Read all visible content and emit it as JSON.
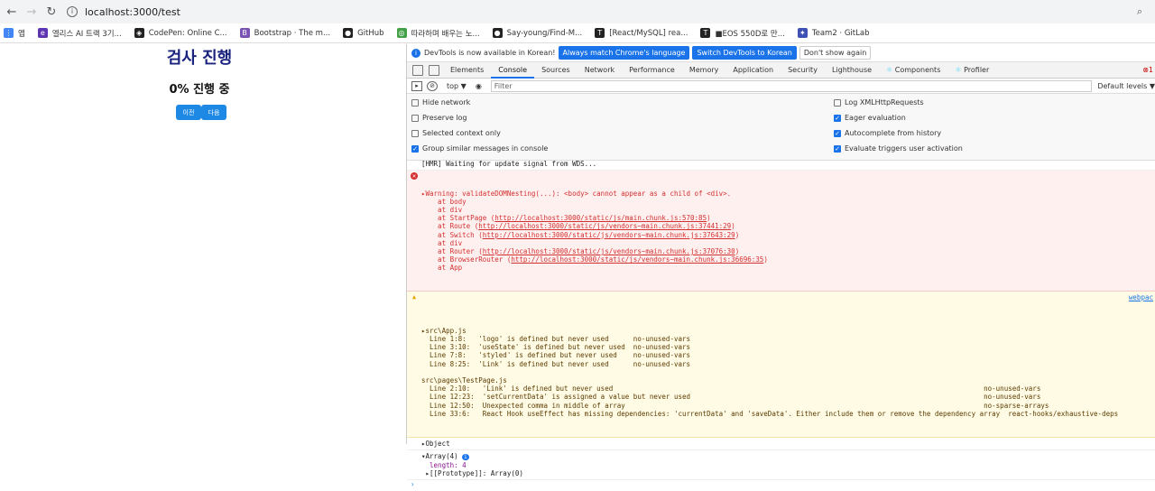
{
  "browser": {
    "url": "localhost:3000/test",
    "bookmarks": [
      {
        "label": "앱",
        "color": "#4285f4"
      },
      {
        "label": "엘리스 AI 트랙 3기...",
        "color": "#5e35b1"
      },
      {
        "label": "CodePen: Online C...",
        "color": "#222222"
      },
      {
        "label": "Bootstrap · The m...",
        "color": "#7952b3"
      },
      {
        "label": "GitHub",
        "color": "#222222"
      },
      {
        "label": "따라하며 배우는 노...",
        "color": "#43a047"
      },
      {
        "label": "Say-young/Find-M...",
        "color": "#222222"
      },
      {
        "label": "[React/MySQL] rea...",
        "color": "#222222"
      },
      {
        "label": "■EOS 550D로 만...",
        "color": "#222222"
      },
      {
        "label": "Team2 · GitLab",
        "color": "#3f51b5"
      }
    ]
  },
  "page": {
    "title": "검사 진행",
    "progress": "0% 진행 중",
    "prev_label": "이전",
    "next_label": "다음"
  },
  "devtools": {
    "info_text": "DevTools is now available in Korean!",
    "btn_match": "Always match Chrome's language",
    "btn_switch": "Switch DevTools to Korean",
    "btn_dont": "Don't show again",
    "tabs": [
      "Elements",
      "Console",
      "Sources",
      "Network",
      "Performance",
      "Memory",
      "Application",
      "Security",
      "Lighthouse",
      "Components",
      "Profiler"
    ],
    "active_tab": "Console",
    "error_count": "1",
    "context": "top ▼",
    "filter_placeholder": "Filter",
    "levels": "Default levels ▼",
    "settings": {
      "hide_network": "Hide network",
      "preserve_log": "Preserve log",
      "selected_context": "Selected context only",
      "group_similar": "Group similar messages in console",
      "log_xhr": "Log XMLHttpRequests",
      "eager_eval": "Eager evaluation",
      "autocomplete": "Autocomplete from history",
      "eval_triggers": "Evaluate triggers user activation"
    },
    "hmr": "[HMR] Waiting for update signal from WDS...",
    "error": {
      "head": "▸Warning: validateDOMNesting(...): <body> cannot appear as a child of <div>.",
      "lines": [
        "    at body",
        "    at div"
      ],
      "stack": [
        {
          "pre": "    at StartPage (",
          "link": "http://localhost:3000/static/js/main.chunk.js:570:85",
          "post": ")"
        },
        {
          "pre": "    at Route (",
          "link": "http://localhost:3000/static/js/vendors~main.chunk.js:37441:29",
          "post": ")"
        },
        {
          "pre": "    at Switch (",
          "link": "http://localhost:3000/static/js/vendors~main.chunk.js:37643:29",
          "post": ")"
        },
        {
          "pre": "    at div",
          "link": "",
          "post": ""
        },
        {
          "pre": "    at Router (",
          "link": "http://localhost:3000/static/js/vendors~main.chunk.js:37076:30",
          "post": ")"
        },
        {
          "pre": "    at BrowserRouter (",
          "link": "http://localhost:3000/static/js/vendors~main.chunk.js:36696:35",
          "post": ")"
        },
        {
          "pre": "    at App",
          "link": "",
          "post": ""
        }
      ]
    },
    "warning": {
      "source": "webpac",
      "text": "▸src\\App.js\n  Line 1:8:   'logo' is defined but never used      no-unused-vars\n  Line 3:10:  'useState' is defined but never used  no-unused-vars\n  Line 7:8:   'styled' is defined but never used    no-unused-vars\n  Line 8:25:  'Link' is defined but never used      no-unused-vars\n\nsrc\\pages\\TestPage.js\n  Line 2:10:   'Link' is defined but never used                                                                                           no-unused-vars\n  Line 12:23:  'setCurrentData' is assigned a value but never used                                                                        no-unused-vars\n  Line 12:50:  Unexpected comma in middle of array                                                                                        no-sparse-arrays\n  Line 33:6:   React Hook useEffect has missing dependencies: 'currentData' and 'saveData'. Either include them or remove the dependency array  react-hooks/exhaustive-deps"
    },
    "object_line": "▸Object",
    "array_line": "▾Array(4)",
    "array_badge": "i",
    "array_length": "  length: 4",
    "array_proto": " ▸[[Prototype]]: Array(0)",
    "prompt": "›"
  }
}
